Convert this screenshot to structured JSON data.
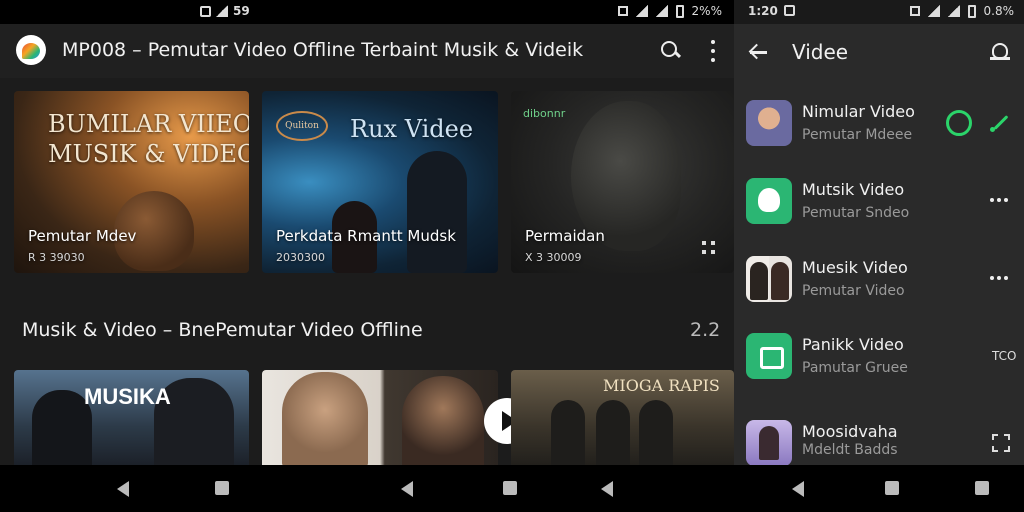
{
  "status_left": {
    "icons": [
      "notification-icon",
      "sim-icon"
    ],
    "text": "59"
  },
  "status_right": {
    "text": "2%%"
  },
  "app": {
    "title": "MP008 – Pemutar Video Offline Terbaint Musik & Videik"
  },
  "cards_top": [
    {
      "title_overlay": "BUMILAR VIIEO\nMUSIK & VIDEO",
      "caption": "Pemutar Mdev",
      "sub": "R 3 39030"
    },
    {
      "brand": "Quliton",
      "title_overlay": "Rux Videe",
      "caption": "Perkdata Rmantt Mudsk",
      "sub": "2030300"
    },
    {
      "brand": "dibonnr",
      "caption": "Permaidan",
      "sub": "X 3 30009"
    }
  ],
  "section": {
    "title": "Musik & Video – BnePemutar Video Offline",
    "count": "2.2"
  },
  "cards_bottom": [
    {
      "overlay": "MUSIKA"
    },
    {},
    {
      "overlay": "MIOGA RAPIS"
    }
  ],
  "panel": {
    "time": "1:20",
    "status_text": "0.8%",
    "title": "Videe",
    "items": [
      {
        "title": "Nimular Video",
        "sub": "Pemutar Mdeee"
      },
      {
        "title": "Mutsik Video",
        "sub": "Pemutar Sndeo"
      },
      {
        "title": "Muesik Video",
        "sub": "Pemutar Video"
      },
      {
        "title": "Panikk Video",
        "sub": "Pamutar Gruee",
        "trail": "TCO"
      },
      {
        "title": "Moosidvaha",
        "sub": "Mdeldt Badds"
      }
    ]
  },
  "colors": {
    "accent": "#2bd46a",
    "background": "#1c1c1c",
    "panel": "#2a2a2a"
  }
}
